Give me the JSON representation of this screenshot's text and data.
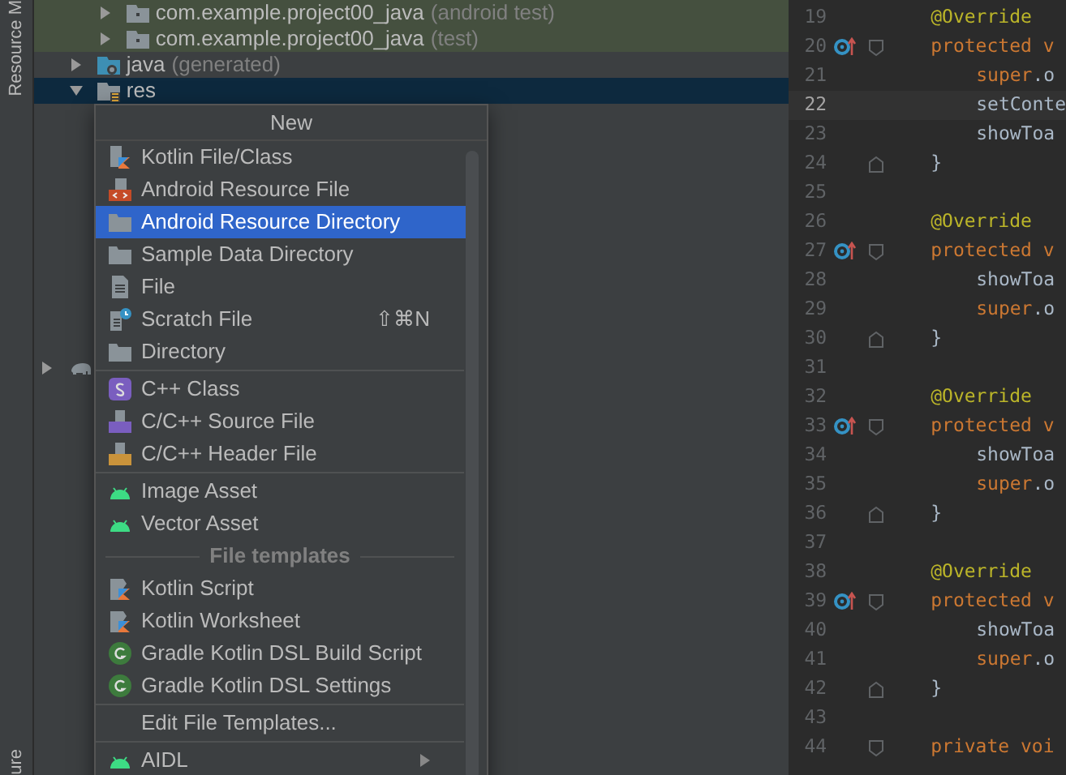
{
  "side_strip": {
    "top_tab": "Resource M",
    "bottom_tab": "ure"
  },
  "project_tree": [
    {
      "kind": "package",
      "label": "com.example.project00_java",
      "hint": "(android test)",
      "expanded": false,
      "selected": false,
      "tinted": true
    },
    {
      "kind": "package",
      "label": "com.example.project00_java",
      "hint": "(test)",
      "expanded": false,
      "selected": false,
      "tinted": true
    },
    {
      "kind": "generated",
      "label": "java",
      "hint": "(generated)",
      "expanded": false,
      "selected": false,
      "tinted": false
    },
    {
      "kind": "resource",
      "label": "res",
      "expanded": true,
      "selected": true,
      "tinted": false
    }
  ],
  "hidden_row": {
    "kind": "gradle",
    "expanded": false
  },
  "context_menu": [
    {
      "kind": "header",
      "label": "New"
    },
    {
      "kind": "kotlin",
      "label": "Kotlin File/Class",
      "selected": false
    },
    {
      "kind": "resource",
      "label": "Android Resource File",
      "selected": false
    },
    {
      "kind": "folder",
      "label": "Android Resource Directory",
      "selected": true
    },
    {
      "kind": "folder",
      "label": "Sample Data Directory",
      "selected": false
    },
    {
      "kind": "file",
      "label": "File",
      "selected": false
    },
    {
      "kind": "scratch",
      "label": "Scratch File",
      "shortcut": "⇧⌘N",
      "selected": false
    },
    {
      "kind": "folder",
      "label": "Directory",
      "selected": false
    },
    {
      "kind": "separator"
    },
    {
      "kind": "cppclass",
      "label": "C++ Class",
      "selected": false
    },
    {
      "kind": "cppsource",
      "label": "C/C++ Source File",
      "selected": false
    },
    {
      "kind": "cppheader",
      "label": "C/C++ Header File",
      "selected": false
    },
    {
      "kind": "separator"
    },
    {
      "kind": "android",
      "label": "Image Asset",
      "selected": false
    },
    {
      "kind": "android",
      "label": "Vector Asset",
      "selected": false
    },
    {
      "kind": "section",
      "label": "File templates"
    },
    {
      "kind": "script",
      "label": "Kotlin Script",
      "selected": false
    },
    {
      "kind": "script",
      "label": "Kotlin Worksheet",
      "selected": false
    },
    {
      "kind": "gradle",
      "label": "Gradle Kotlin DSL Build Script",
      "selected": false
    },
    {
      "kind": "gradle",
      "label": "Gradle Kotlin DSL Settings",
      "selected": false
    },
    {
      "kind": "separator"
    },
    {
      "kind": "plain",
      "label": "Edit File Templates...",
      "selected": false
    },
    {
      "kind": "separator"
    },
    {
      "kind": "android",
      "label": "AIDL",
      "submenu": true,
      "selected": false
    }
  ],
  "editor_lines": [
    {
      "number": "19",
      "kind": "annotation",
      "code": [
        {
          "text": "@Override",
          "kind": "annotation"
        }
      ],
      "current": false
    },
    {
      "number": "20",
      "kind": "header",
      "code": [
        {
          "text": "protected v",
          "kind": "keyword"
        }
      ],
      "current": false,
      "override": true
    },
    {
      "number": "21",
      "kind": "body",
      "code": [
        {
          "text": "super",
          "kind": "keyword"
        },
        {
          "text": ".o",
          "kind": "plain"
        }
      ],
      "current": false
    },
    {
      "number": "22",
      "kind": "body",
      "code": [
        {
          "text": "setConte",
          "kind": "plain"
        }
      ],
      "current": true
    },
    {
      "number": "23",
      "kind": "body",
      "code": [
        {
          "text": "showToa",
          "kind": "plain"
        }
      ],
      "current": false
    },
    {
      "number": "24",
      "kind": "closer",
      "code": [
        {
          "text": "}",
          "kind": "plain"
        }
      ],
      "current": false
    },
    {
      "number": "25",
      "kind": "blank",
      "current": false
    },
    {
      "number": "26",
      "kind": "annotation",
      "code": [
        {
          "text": "@Override",
          "kind": "annotation"
        }
      ],
      "current": false
    },
    {
      "number": "27",
      "kind": "header",
      "code": [
        {
          "text": "protected v",
          "kind": "keyword"
        }
      ],
      "current": false,
      "override": true
    },
    {
      "number": "28",
      "kind": "body",
      "code": [
        {
          "text": "showToa",
          "kind": "plain"
        }
      ],
      "current": false
    },
    {
      "number": "29",
      "kind": "body",
      "code": [
        {
          "text": "super",
          "kind": "keyword"
        },
        {
          "text": ".o",
          "kind": "plain"
        }
      ],
      "current": false
    },
    {
      "number": "30",
      "kind": "closer",
      "code": [
        {
          "text": "}",
          "kind": "plain"
        }
      ],
      "current": false
    },
    {
      "number": "31",
      "kind": "blank",
      "current": false
    },
    {
      "number": "32",
      "kind": "annotation",
      "code": [
        {
          "text": "@Override",
          "kind": "annotation"
        }
      ],
      "current": false
    },
    {
      "number": "33",
      "kind": "header",
      "code": [
        {
          "text": "protected v",
          "kind": "keyword"
        }
      ],
      "current": false,
      "override": true
    },
    {
      "number": "34",
      "kind": "body",
      "code": [
        {
          "text": "showToa",
          "kind": "plain"
        }
      ],
      "current": false
    },
    {
      "number": "35",
      "kind": "body",
      "code": [
        {
          "text": "super",
          "kind": "keyword"
        },
        {
          "text": ".o",
          "kind": "plain"
        }
      ],
      "current": false
    },
    {
      "number": "36",
      "kind": "closer",
      "code": [
        {
          "text": "}",
          "kind": "plain"
        }
      ],
      "current": false
    },
    {
      "number": "37",
      "kind": "blank",
      "current": false
    },
    {
      "number": "38",
      "kind": "annotation",
      "code": [
        {
          "text": "@Override",
          "kind": "annotation"
        }
      ],
      "current": false
    },
    {
      "number": "39",
      "kind": "header",
      "code": [
        {
          "text": "protected v",
          "kind": "keyword"
        }
      ],
      "current": false,
      "override": true
    },
    {
      "number": "40",
      "kind": "body",
      "code": [
        {
          "text": "showToa",
          "kind": "plain"
        }
      ],
      "current": false
    },
    {
      "number": "41",
      "kind": "body",
      "code": [
        {
          "text": "super",
          "kind": "keyword"
        },
        {
          "text": ".o",
          "kind": "plain"
        }
      ],
      "current": false
    },
    {
      "number": "42",
      "kind": "closer",
      "code": [
        {
          "text": "}",
          "kind": "plain"
        }
      ],
      "current": false
    },
    {
      "number": "43",
      "kind": "blank",
      "current": false
    },
    {
      "number": "44",
      "kind": "header",
      "code": [
        {
          "text": "private voi",
          "kind": "keyword"
        }
      ],
      "current": false
    }
  ]
}
